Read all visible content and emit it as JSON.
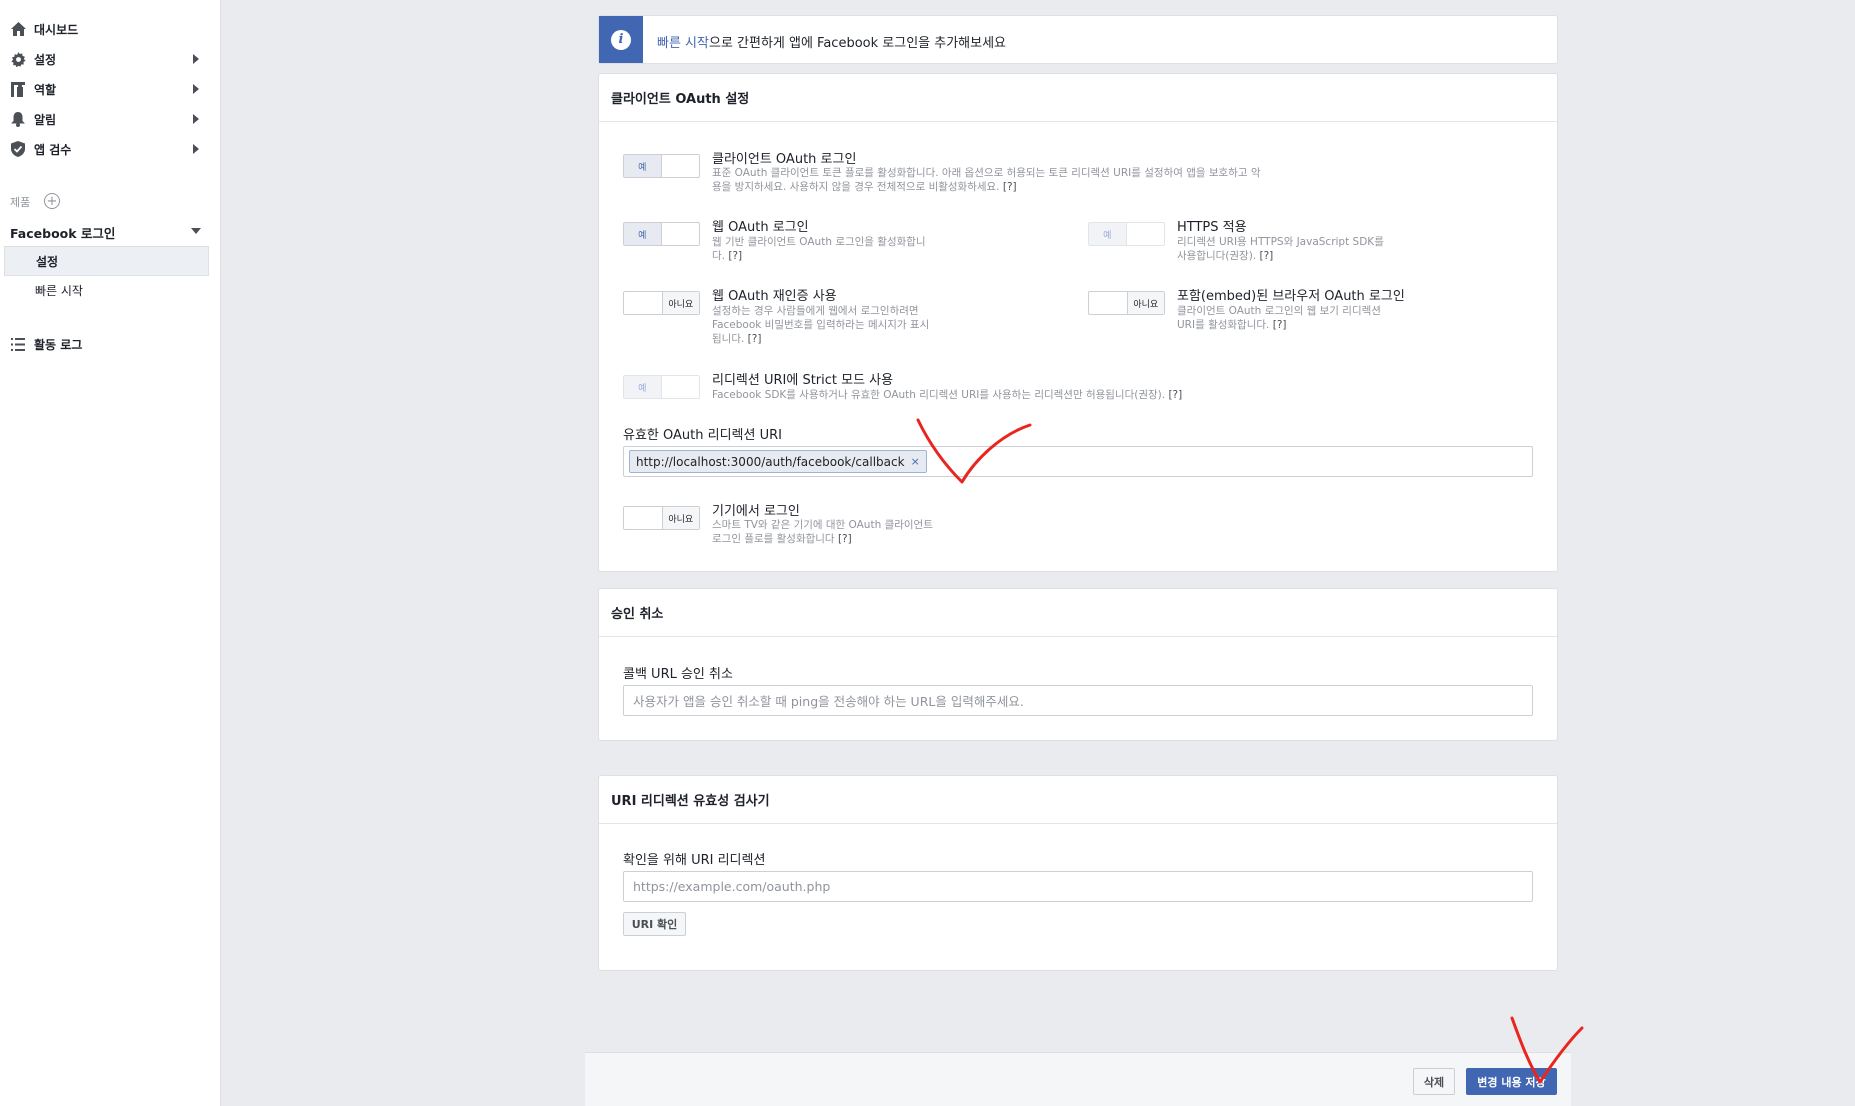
{
  "sidebar": {
    "items": [
      {
        "label": "대시보드",
        "icon": "home-icon",
        "has_arrow": false
      },
      {
        "label": "설정",
        "icon": "gear-icon",
        "has_arrow": true
      },
      {
        "label": "역할",
        "icon": "roles-icon",
        "has_arrow": true
      },
      {
        "label": "알림",
        "icon": "bell-icon",
        "has_arrow": true
      },
      {
        "label": "앱 검수",
        "icon": "shield-check-icon",
        "has_arrow": true
      }
    ],
    "products_label": "제품",
    "product_name": "Facebook 로그인",
    "product_sub": [
      "설정",
      "빠른 시작"
    ],
    "activity_log": "활동 로그"
  },
  "banner": {
    "link_text": "빠른 시작",
    "rest_text": "으로 간편하게 앱에 Facebook 로그인을 추가해보세요"
  },
  "oauth": {
    "title": "클라이언트 OAuth 설정",
    "yes": "예",
    "no": "아니요",
    "settings": {
      "client_oauth": {
        "title": "클라이언트 OAuth 로그인",
        "desc1": "표준 OAuth 클라이언트 토큰 플로를 활성화합니다. 아래 옵션으로 허용되는 토큰 리디렉션 URI를 설정하여 앱을 보호하고 악",
        "desc2": "용을 방지하세요. 사용하지 않을 경우 전체적으로 비활성화하세요.",
        "state": "on"
      },
      "web_oauth": {
        "title": "웹 OAuth 로그인",
        "desc1": "웹 기반 클라이언트 OAuth 로그인을 활성화합니",
        "desc2": "다.",
        "state": "on"
      },
      "https": {
        "title": "HTTPS 적용",
        "desc1": "리디렉션 URI용 HTTPS와 JavaScript SDK를",
        "desc2": "사용합니다(권장).",
        "state": "on-disabled"
      },
      "web_reauth": {
        "title": "웹 OAuth 재인증 사용",
        "desc1": "설정하는 경우 사람들에게 웹에서 로그인하려면",
        "desc2": "Facebook 비밀번호를 입력하라는 메시지가 표시",
        "desc3": "됩니다.",
        "state": "off"
      },
      "embedded": {
        "title": "포함(embed)된 브라우저 OAuth 로그인",
        "desc1": "클라이언트 OAuth 로그인의 웹 보기 리디렉션",
        "desc2": "URI를 활성화합니다.",
        "state": "off"
      },
      "strict": {
        "title": "리디렉션 URI에 Strict 모드 사용",
        "desc1": "Facebook SDK를 사용하거나 유효한 OAuth 리디렉션 URI를 사용하는 리디렉션만 허용됩니다(권장).",
        "state": "on-disabled"
      },
      "device": {
        "title": "기기에서 로그인",
        "desc1": "스마트 TV와 같은 기기에 대한 OAuth 클라이언트",
        "desc2": "로그인 플로를 활성화합니다",
        "state": "off"
      }
    },
    "help": "[?]",
    "redirect_label": "유효한 OAuth 리디렉션 URI",
    "redirect_uri": "http://localhost:3000/auth/facebook/callback",
    "token_remove": "×"
  },
  "deauth": {
    "title": "승인 취소",
    "field_label": "콜백 URL 승인 취소",
    "placeholder": "사용자가 앱을 승인 취소할 때 ping을 전송해야 하는 URL을 입력해주세요."
  },
  "validator": {
    "title": "URI 리디렉션 유효성 검사기",
    "field_label": "확인을 위해 URI 리디렉션",
    "placeholder": "https://example.com/oauth.php",
    "check_button": "URI 확인"
  },
  "footer": {
    "delete": "삭제",
    "save": "변경 내용 저장"
  },
  "colors": {
    "accent": "#4267b2",
    "annotation": "#e8261f"
  }
}
